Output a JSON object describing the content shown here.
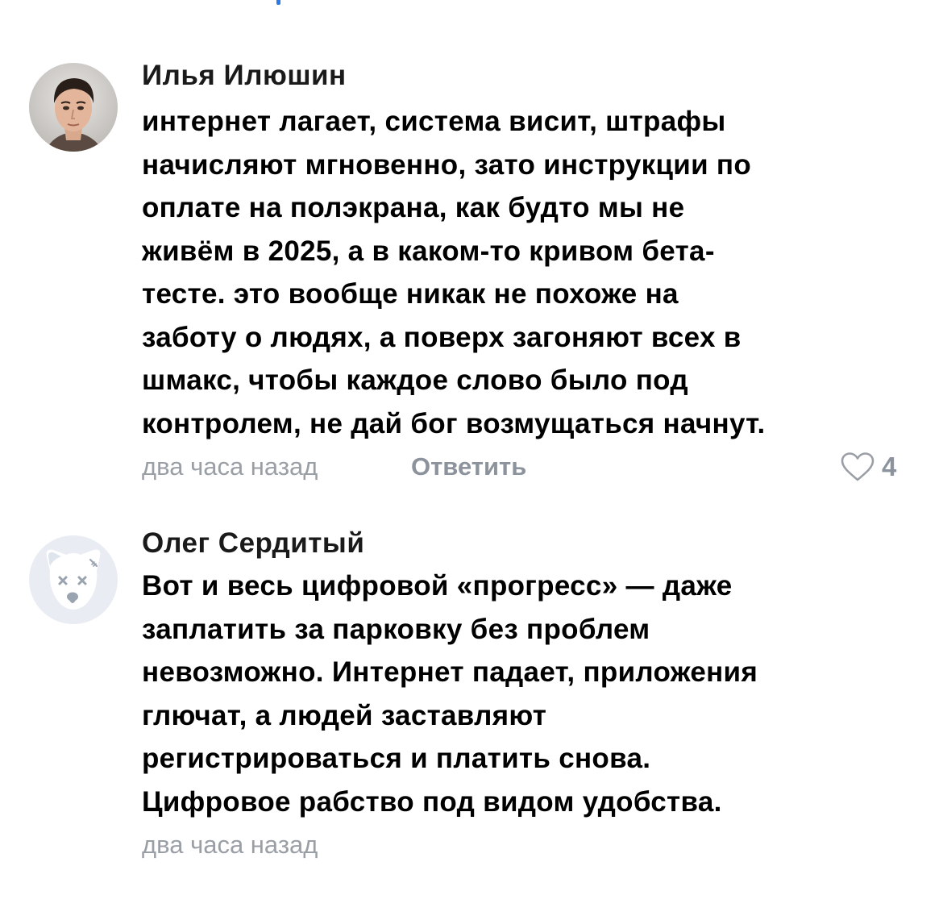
{
  "comments": [
    {
      "author": "Илья Илюшин",
      "avatar": "user-photo",
      "text": "интернет лагает, система висит, штрафы\nначисляют мгновенно, зато инструкции по\nоплате на полэкрана, как будто мы не\nживём в 2025, а в каком-то кривом бета-\nтесте. это вообще никак не похоже на\nзаботу о людях, а поверх загоняют всех в\nшмакс, чтобы каждое слово было под\nконтролем, не дай бог возмущаться начнут.",
      "time": "два часа назад",
      "reply_label": "Ответить",
      "likes": "4"
    },
    {
      "author": "Олег Сердитый",
      "avatar": "deactivated-dog-avatar",
      "text": "Вот и весь цифровой «прогресс» — даже\nзаплатить за парковку без проблем\nневозможно. Интернет падает, приложения\nглючат, а людей заставляют\nрегистрироваться и платить снова.\nЦифровое рабство под видом удобства.",
      "time": "два часа назад"
    }
  ],
  "colors": {
    "meta_text": "#9a9ea5",
    "accent": "#2c7be5"
  },
  "icons": {
    "like": "heart-outline-icon"
  }
}
